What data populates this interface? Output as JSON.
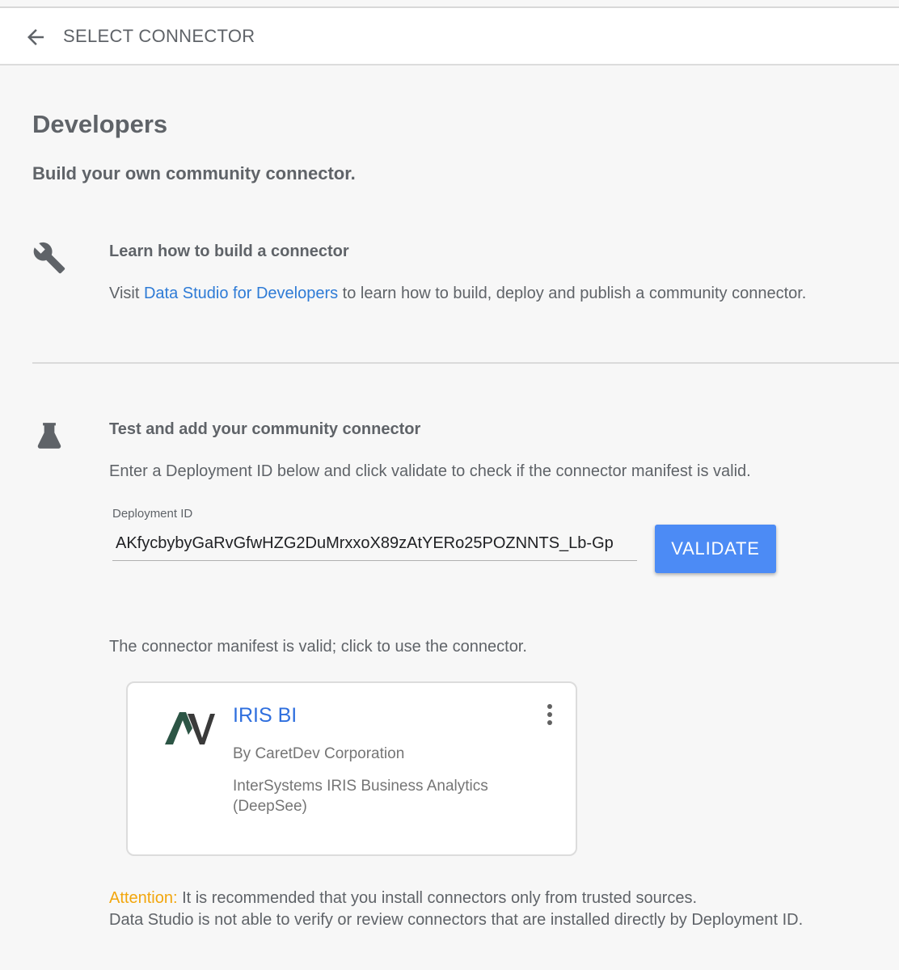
{
  "header": {
    "title": "SELECT CONNECTOR",
    "back_icon": "arrow-back-icon"
  },
  "page": {
    "title": "Developers",
    "subtitle": "Build your own community connector."
  },
  "learn_section": {
    "icon": "wrench-icon",
    "title": "Learn how to build a connector",
    "text_before_link": "Visit ",
    "link_text": "Data Studio for Developers",
    "text_after_link": " to learn how to build, deploy and publish a community connector."
  },
  "test_section": {
    "icon": "flask-icon",
    "title": "Test and add your community connector",
    "text": "Enter a Deployment ID below and click validate to check if the connector manifest is valid.",
    "field_label": "Deployment ID",
    "field_value": "AKfycbybyGaRvGfwHZG2DuMrxxoX89zAtYERo25POZNNTS_Lb-Gp",
    "validate_label": "VALIDATE",
    "validate_color": "#4c8bf5"
  },
  "result": {
    "message": "The connector manifest is valid; click to use the connector.",
    "connector": {
      "name": "IRIS BI",
      "author": "By CaretDev Corporation",
      "description": "InterSystems IRIS Business Analytics (DeepSee)",
      "logo_icon": "av-logo-icon",
      "more_icon": "more-vert-icon"
    }
  },
  "attention": {
    "label": "Attention:",
    "line1": " It is recommended that you install connectors only from trusted sources.",
    "line2": "Data Studio is not able to verify or review connectors that are installed directly by Deployment ID.",
    "label_color": "#f2a60d"
  }
}
